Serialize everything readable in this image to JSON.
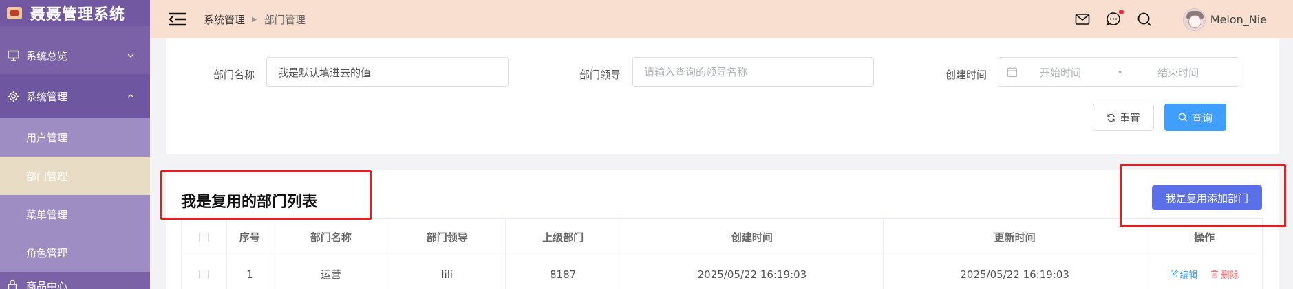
{
  "app": {
    "title": "聂聂管理系统"
  },
  "sidebar": {
    "overview_label": "系统总览",
    "system_label": "系统管理",
    "items": [
      {
        "label": "用户管理",
        "active": false
      },
      {
        "label": "部门管理",
        "active": true
      },
      {
        "label": "菜单管理",
        "active": false
      },
      {
        "label": "角色管理",
        "active": false
      }
    ],
    "bottom_label": "商品中心"
  },
  "header": {
    "breadcrumb": [
      "系统管理",
      "部门管理"
    ],
    "username": "Melon_Nie",
    "icons": [
      "mail-icon",
      "chat-icon",
      "search-icon"
    ]
  },
  "search": {
    "dept_name_label": "部门名称",
    "dept_name_value": "我是默认填进去的值",
    "leader_label": "部门领导",
    "leader_placeholder": "请输入查询的领导名称",
    "created_label": "创建时间",
    "start_placeholder": "开始时间",
    "range_separator": "-",
    "end_placeholder": "结束时间",
    "reset_label": "重置",
    "query_label": "查询"
  },
  "list": {
    "title": "我是复用的部门列表",
    "add_label": "我是复用添加部门",
    "columns": [
      "序号",
      "部门名称",
      "部门领导",
      "上级部门",
      "创建时间",
      "更新时间",
      "操作"
    ],
    "rows": [
      {
        "index": "1",
        "name": "运营",
        "leader": "lili",
        "parent": "8187",
        "created": "2025/05/22 16:19:03",
        "updated": "2025/05/22 16:19:03",
        "edit": "编辑",
        "delete": "删除"
      }
    ]
  },
  "colors": {
    "sidebar": "#7b62a6",
    "header": "#f8dfcf",
    "primary": "#409eff",
    "add_button": "#5a6fe8",
    "annotation": "#e02020"
  }
}
